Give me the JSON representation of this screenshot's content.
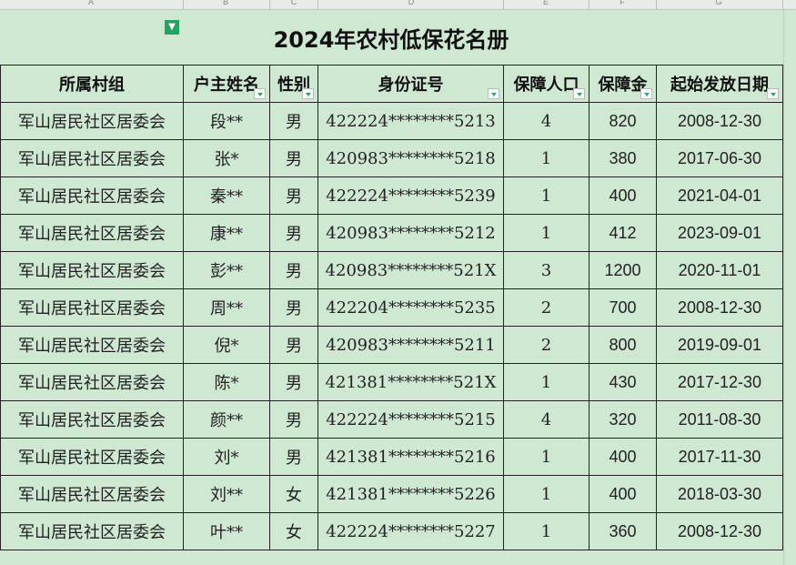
{
  "column_letters": [
    "A",
    "B",
    "C",
    "D",
    "E",
    "F",
    "G"
  ],
  "title": "2024年农村低保花名册",
  "headers": {
    "village": "所属村组",
    "name": "户主姓名",
    "gender": "性别",
    "id": "身份证号",
    "people": "保障人口",
    "amount": "保障金",
    "start_date": "起始发放日期"
  },
  "rows": [
    {
      "village": "军山居民社区居委会",
      "name": "段**",
      "gender": "男",
      "id": "422224********5213",
      "people": "4",
      "amount": "820",
      "start_date": "2008-12-30"
    },
    {
      "village": "军山居民社区居委会",
      "name": "张*",
      "gender": "男",
      "id": "420983********5218",
      "people": "1",
      "amount": "380",
      "start_date": "2017-06-30"
    },
    {
      "village": "军山居民社区居委会",
      "name": "秦**",
      "gender": "男",
      "id": "422224********5239",
      "people": "1",
      "amount": "400",
      "start_date": "2021-04-01"
    },
    {
      "village": "军山居民社区居委会",
      "name": "康**",
      "gender": "男",
      "id": "420983********5212",
      "people": "1",
      "amount": "412",
      "start_date": "2023-09-01"
    },
    {
      "village": "军山居民社区居委会",
      "name": "彭**",
      "gender": "男",
      "id": "420983********521X",
      "people": "3",
      "amount": "1200",
      "start_date": "2020-11-01"
    },
    {
      "village": "军山居民社区居委会",
      "name": "周**",
      "gender": "男",
      "id": "422204********5235",
      "people": "2",
      "amount": "700",
      "start_date": "2008-12-30"
    },
    {
      "village": "军山居民社区居委会",
      "name": "倪*",
      "gender": "男",
      "id": "420983********5211",
      "people": "2",
      "amount": "800",
      "start_date": "2019-09-01"
    },
    {
      "village": "军山居民社区居委会",
      "name": "陈*",
      "gender": "男",
      "id": "421381********521X",
      "people": "1",
      "amount": "430",
      "start_date": "2017-12-30"
    },
    {
      "village": "军山居民社区居委会",
      "name": "颜**",
      "gender": "男",
      "id": "422224********5215",
      "people": "4",
      "amount": "320",
      "start_date": "2011-08-30"
    },
    {
      "village": "军山居民社区居委会",
      "name": "刘*",
      "gender": "男",
      "id": "421381********5216",
      "people": "1",
      "amount": "400",
      "start_date": "2017-11-30"
    },
    {
      "village": "军山居民社区居委会",
      "name": "刘**",
      "gender": "女",
      "id": "421381********5226",
      "people": "1",
      "amount": "400",
      "start_date": "2018-03-30"
    },
    {
      "village": "军山居民社区居委会",
      "name": "叶**",
      "gender": "女",
      "id": "422224********5227",
      "people": "1",
      "amount": "360",
      "start_date": "2008-12-30"
    }
  ],
  "colors": {
    "sheet_bg": "#cfe8d2",
    "border": "#222222",
    "filter_accent": "#25a264"
  },
  "icons": {
    "filter_active": "filter-active-icon",
    "dropdown": "dropdown-arrow-icon"
  }
}
